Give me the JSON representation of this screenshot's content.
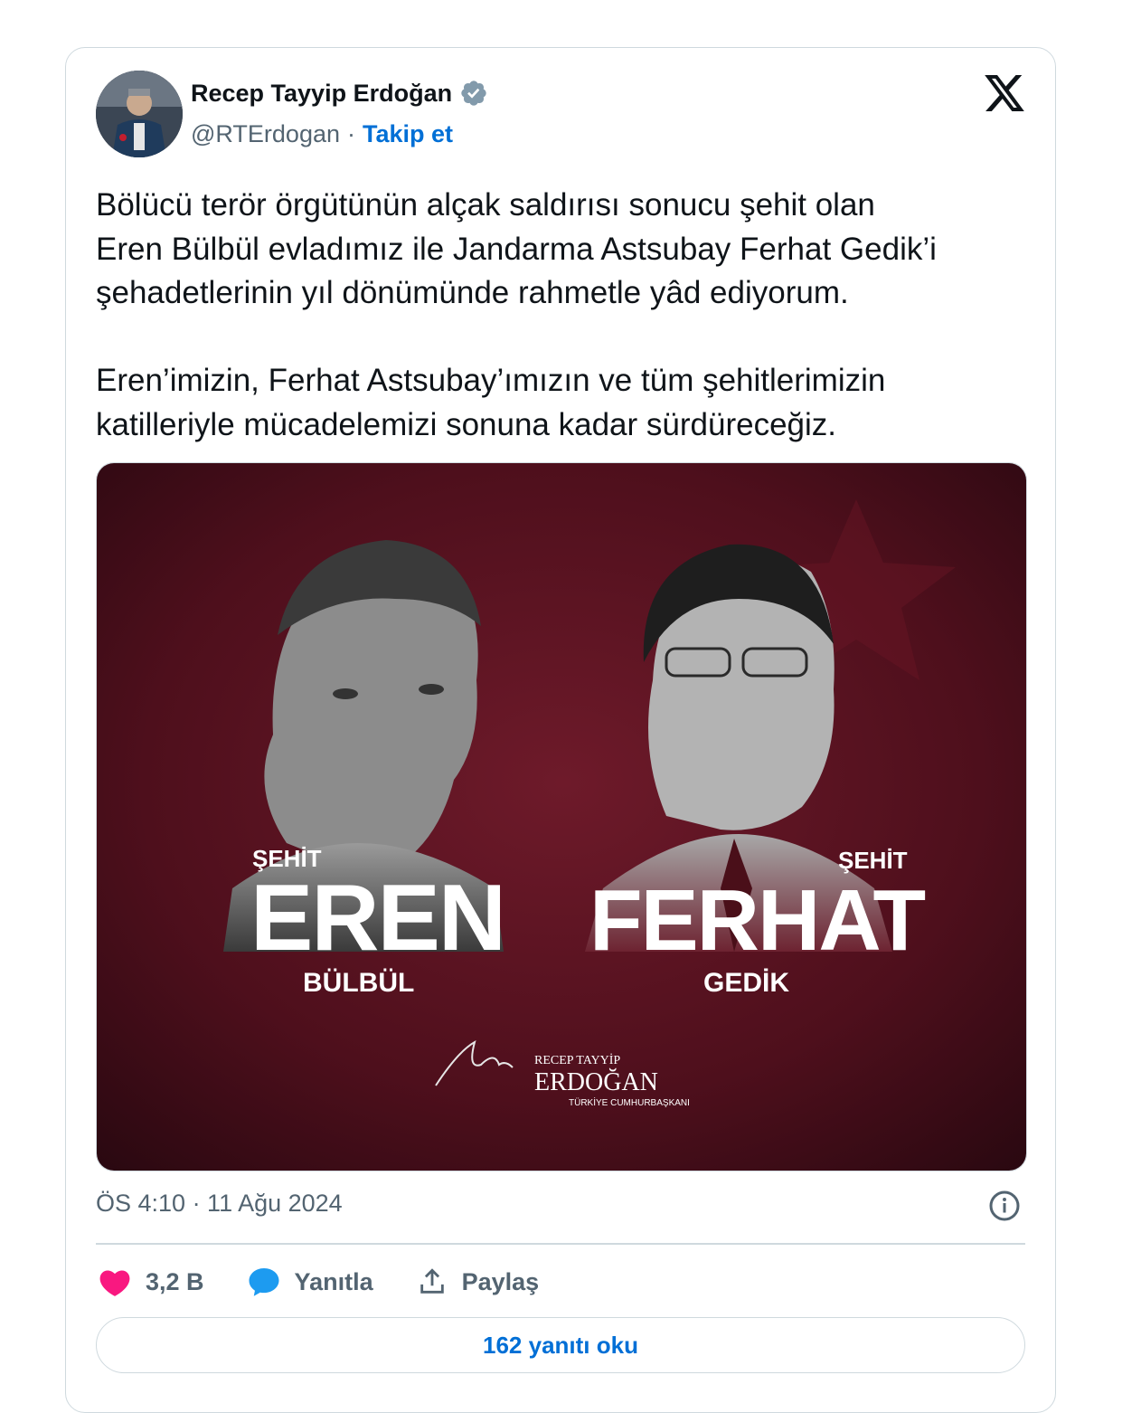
{
  "author": {
    "name": "Recep Tayyip Erdoğan",
    "handle": "@RTErdogan",
    "separator": "·",
    "follow_label": "Takip et"
  },
  "platform_icon": "x-logo-icon",
  "tweet": {
    "text": "Bölücü terör örgütünün alçak saldırısı sonucu şehit olan\nEren Bülbül evladımız ile Jandarma Astsubay Ferhat Gedik’i\nşehadetlerinin yıl dönümünde rahmetle yâd ediyorum.\n\nEren’imizin, Ferhat Astsubay’ımızın ve tüm şehitlerimizin\nkatilleriyle mücadelemizi sonuna kadar sürdüreceğiz."
  },
  "media": {
    "left": {
      "prefix": "ŞEHİT",
      "first": "EREN",
      "last": "BÜLBÜL"
    },
    "right": {
      "prefix": "ŞEHİT",
      "first": "FERHAT",
      "last": "GEDİK"
    },
    "signature": {
      "line1": "RECEP TAYYİP",
      "line2": "ERDOĞAN",
      "line3": "TÜRKİYE CUMHURBAŞKANI"
    },
    "colors": {
      "background": "#5a1220",
      "accent": "#ffffff"
    }
  },
  "meta": {
    "timestamp": "ÖS 4:10 · 11 Ağu 2024"
  },
  "actions": {
    "likes": "3,2 B",
    "reply_label": "Yanıtla",
    "share_label": "Paylaş"
  },
  "read_replies_label": "162 yanıtı oku",
  "colors": {
    "link": "#006fd6",
    "like": "#f91880",
    "reply": "#1d9bf0",
    "muted": "#536471",
    "verified": "#829aab"
  }
}
